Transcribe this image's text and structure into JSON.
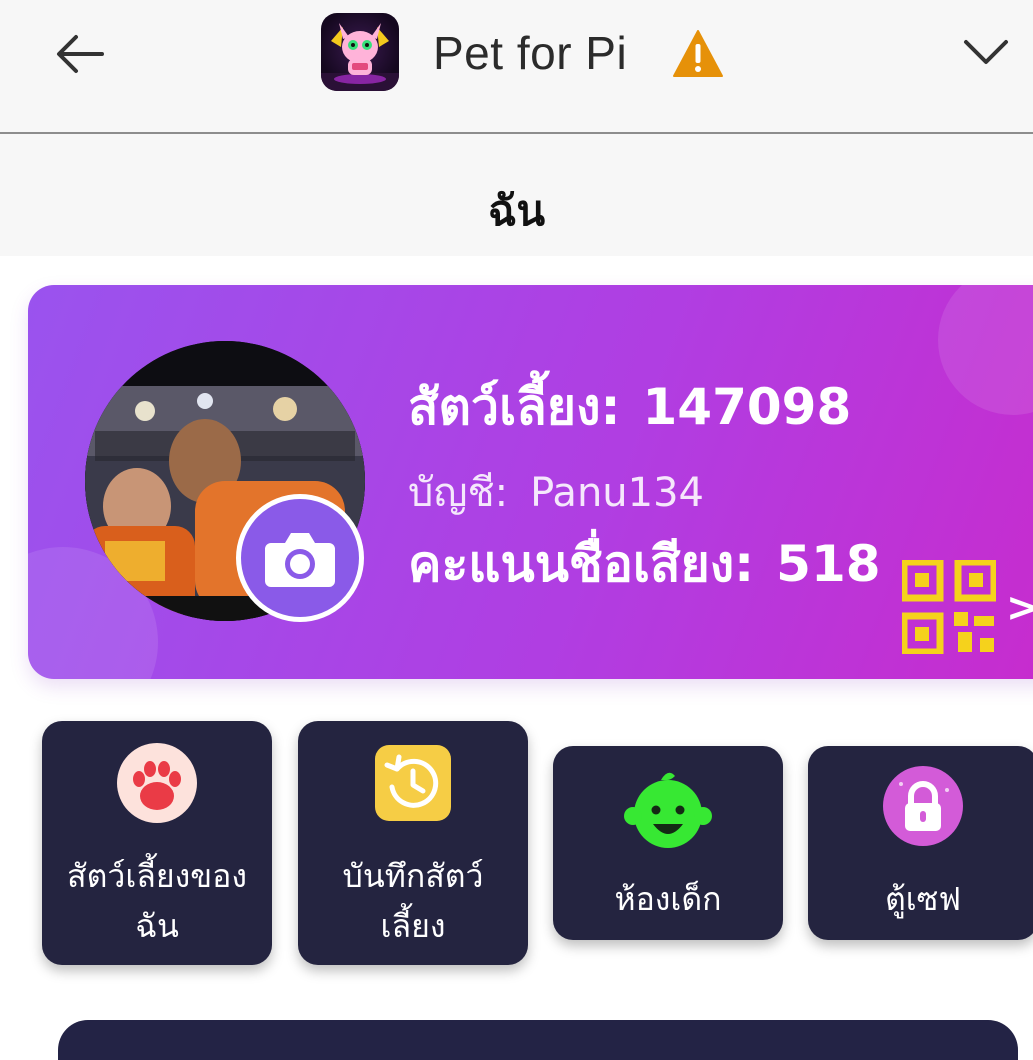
{
  "app": {
    "name": "Pet for Pi",
    "logo_icon": "pet-monster-logo-icon",
    "warning_icon": "warning-triangle-icon",
    "back_icon": "arrow-left-icon",
    "menu_icon": "chevron-down-icon"
  },
  "page": {
    "title": "ฉัน"
  },
  "profile": {
    "pet_id_label": "สัตว์เลี้ยง:",
    "pet_id_value": "147098",
    "account_label": "บัญชี:",
    "account_value": "Panu134",
    "reputation_label": "คะแนนชื่อเสียง:",
    "reputation_value": "518",
    "qr_icon": "qr-code-icon",
    "qr_arrow": ">",
    "camera_icon": "camera-icon"
  },
  "menu": {
    "items": [
      {
        "label_line1": "สัตว์เลี้ยงของ",
        "label_line2": "ฉัน",
        "icon": "paw-icon"
      },
      {
        "label_line1": "บันทึกสัตว์",
        "label_line2": "เลี้ยง",
        "icon": "history-clock-icon"
      },
      {
        "label_line1": "ห้องเด็ก",
        "icon": "baby-face-icon"
      },
      {
        "label_line1": "ตู้เซฟ",
        "icon": "lock-icon"
      }
    ]
  },
  "colors": {
    "card_gradient_start": "#9a53ee",
    "card_gradient_end": "#c82bcd",
    "tile_bg": "#242440",
    "qr_yellow": "#f5d21c",
    "warning_orange": "#e69109"
  }
}
